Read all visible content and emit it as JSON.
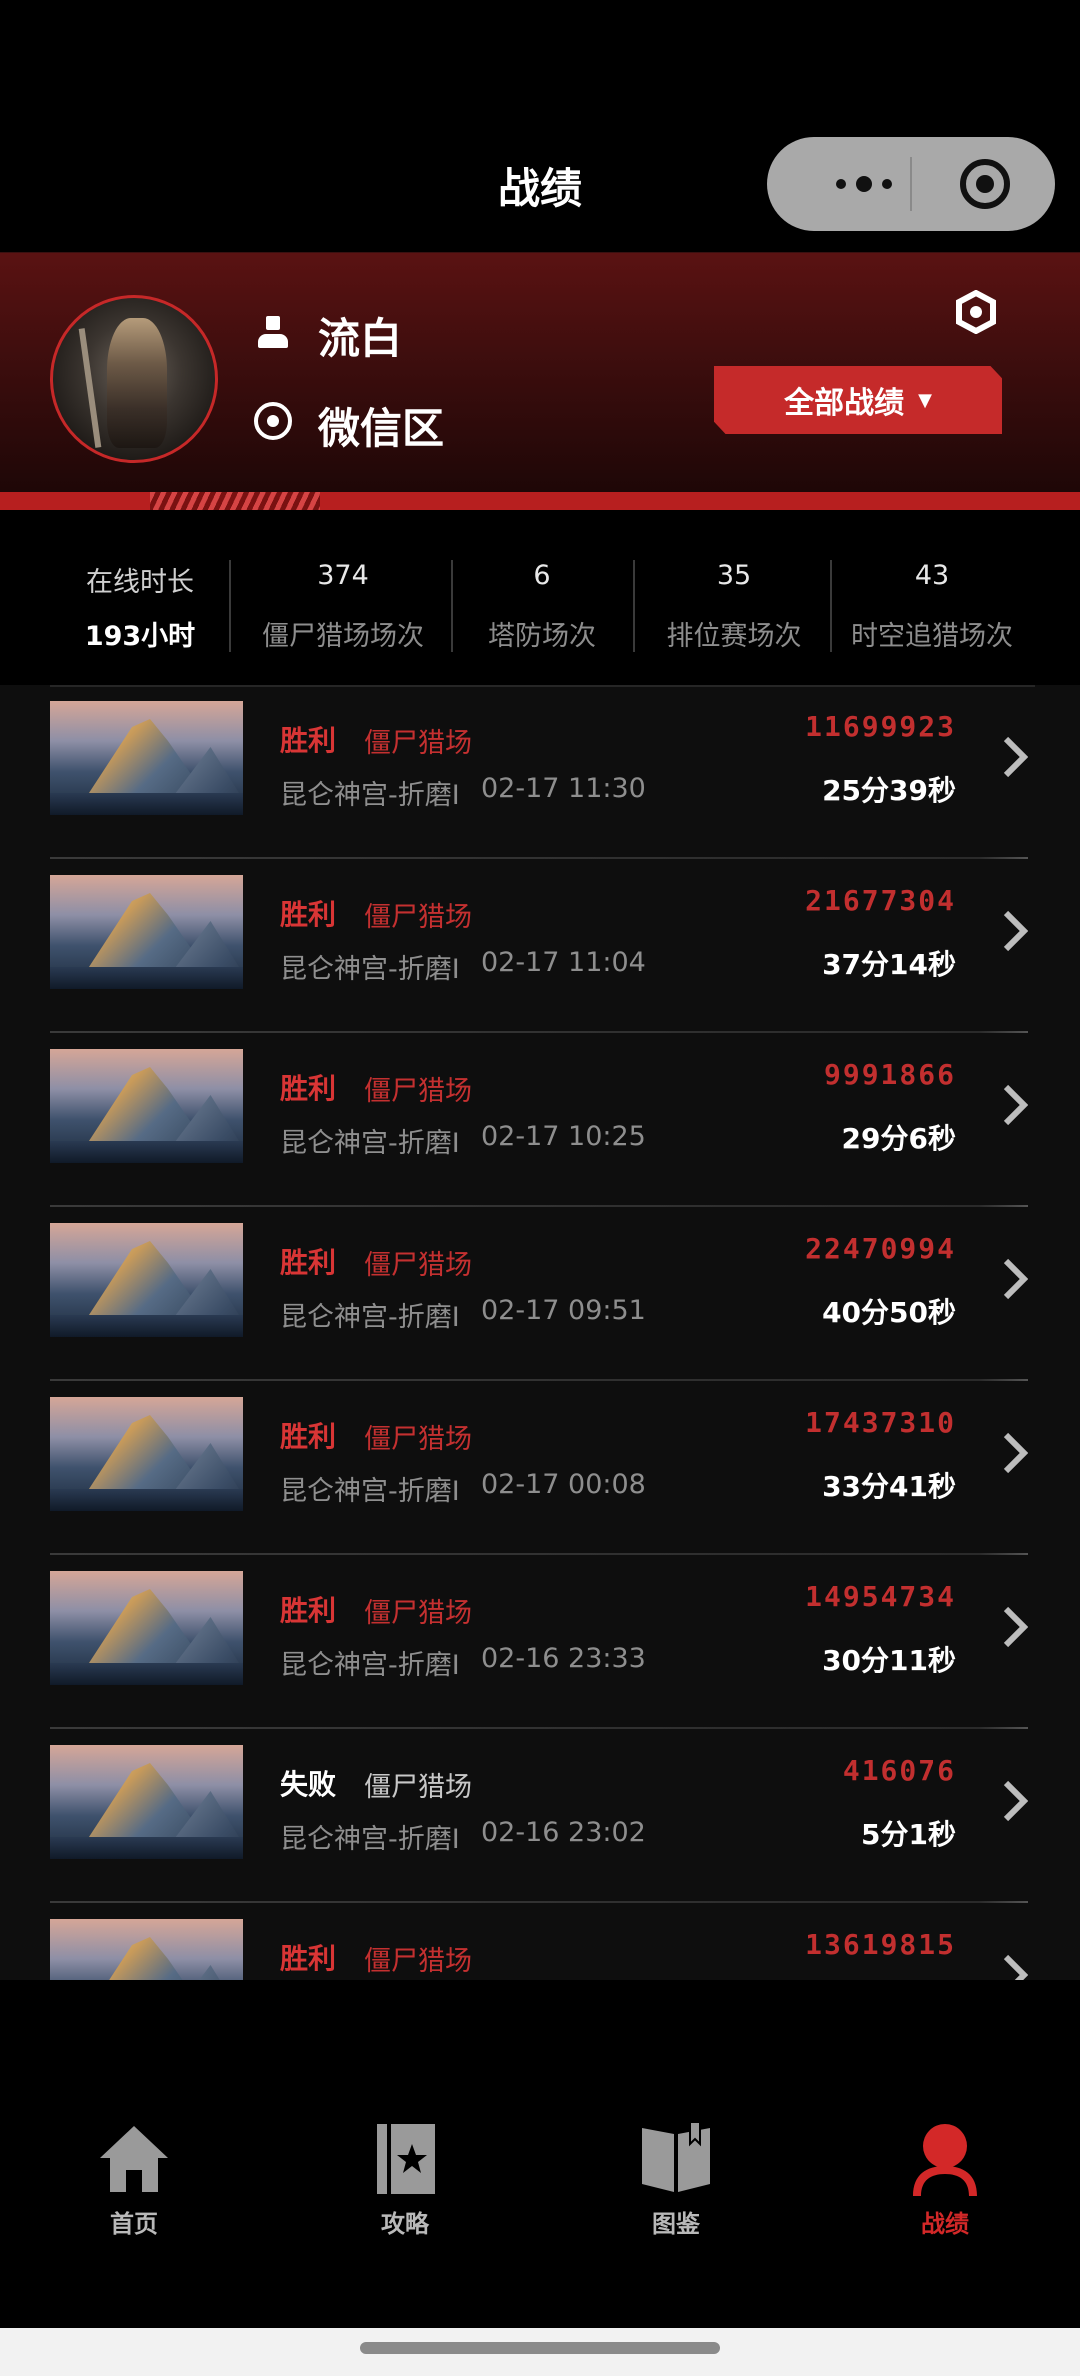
{
  "nav": {
    "title": "战绩"
  },
  "profile": {
    "username": "流白",
    "region": "微信区",
    "filter_button": "全部战绩",
    "filter_caret": "▼",
    "accent_color": "#c52a2a"
  },
  "stats": {
    "online": {
      "label": "在线时长",
      "value": "193小时"
    },
    "items": [
      {
        "value": "374",
        "label": "僵尸猎场场次"
      },
      {
        "value": "6",
        "label": "塔防场次"
      },
      {
        "value": "35",
        "label": "排位赛场次"
      },
      {
        "value": "43",
        "label": "时空追猎场次"
      }
    ]
  },
  "records": [
    {
      "result": "胜利",
      "outcome": "win",
      "mode": "僵尸猎场",
      "map": "昆仑神宫-折磨I",
      "time": "02-17 11:30",
      "score": "11699923",
      "duration": "25分39秒"
    },
    {
      "result": "胜利",
      "outcome": "win",
      "mode": "僵尸猎场",
      "map": "昆仑神宫-折磨I",
      "time": "02-17 11:04",
      "score": "21677304",
      "duration": "37分14秒"
    },
    {
      "result": "胜利",
      "outcome": "win",
      "mode": "僵尸猎场",
      "map": "昆仑神宫-折磨I",
      "time": "02-17 10:25",
      "score": "9991866",
      "duration": "29分6秒"
    },
    {
      "result": "胜利",
      "outcome": "win",
      "mode": "僵尸猎场",
      "map": "昆仑神宫-折磨I",
      "time": "02-17 09:51",
      "score": "22470994",
      "duration": "40分50秒"
    },
    {
      "result": "胜利",
      "outcome": "win",
      "mode": "僵尸猎场",
      "map": "昆仑神宫-折磨I",
      "time": "02-17 00:08",
      "score": "17437310",
      "duration": "33分41秒"
    },
    {
      "result": "胜利",
      "outcome": "win",
      "mode": "僵尸猎场",
      "map": "昆仑神宫-折磨I",
      "time": "02-16 23:33",
      "score": "14954734",
      "duration": "30分11秒"
    },
    {
      "result": "失败",
      "outcome": "lose",
      "mode": "僵尸猎场",
      "map": "昆仑神宫-折磨I",
      "time": "02-16 23:02",
      "score": "416076",
      "duration": "5分1秒"
    },
    {
      "result": "胜利",
      "outcome": "win",
      "mode": "僵尸猎场",
      "map": "",
      "time": "",
      "score": "13619815",
      "duration": ""
    }
  ],
  "tabbar": [
    {
      "label": "首页",
      "icon": "home-icon",
      "active": false
    },
    {
      "label": "攻略",
      "icon": "guide-book-icon",
      "active": false
    },
    {
      "label": "图鉴",
      "icon": "open-book-icon",
      "active": false
    },
    {
      "label": "战绩",
      "icon": "profile-icon",
      "active": true
    }
  ]
}
